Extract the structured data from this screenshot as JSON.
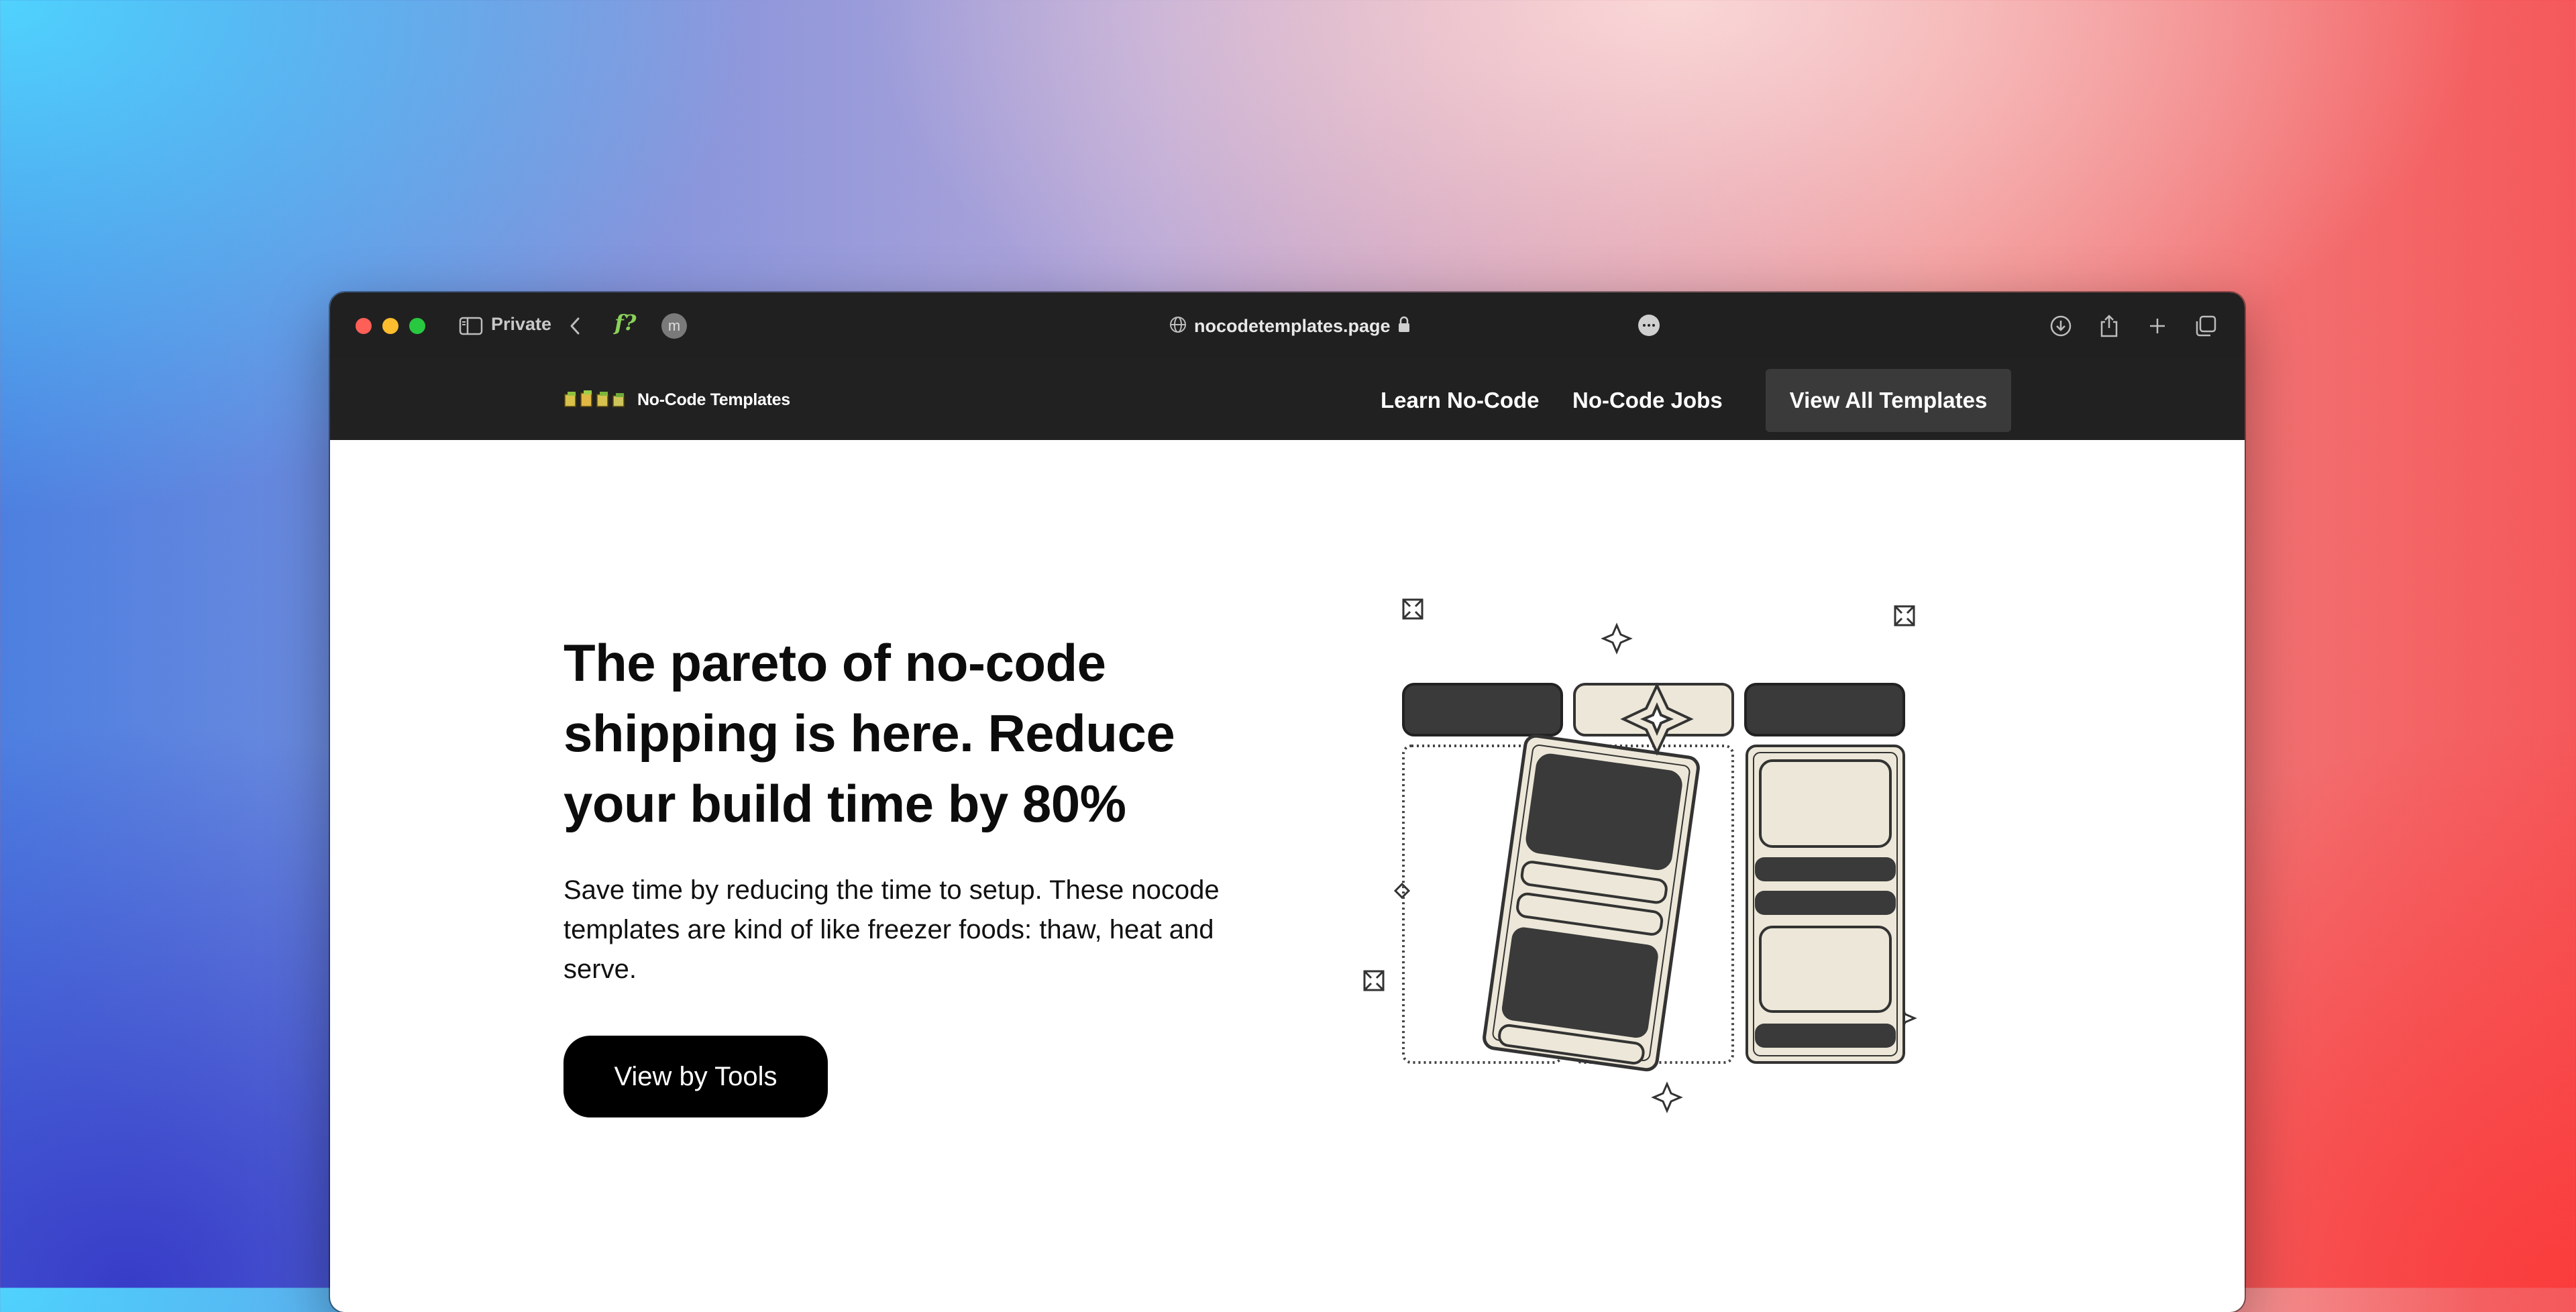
{
  "browser": {
    "private_label": "Private",
    "extension_label": "f?",
    "profile_initial": "m",
    "url": "nocodetemplates.page"
  },
  "site": {
    "brand_name": "No-Code Templates",
    "nav": {
      "learn": "Learn No-Code",
      "jobs": "No-Code Jobs",
      "cta": "View All Templates"
    }
  },
  "hero": {
    "title": "The pareto of no-code shipping is here. Reduce your build time by 80%",
    "subtitle": "Save time by reducing the time to setup. These nocode templates are kind of like freezer foods: thaw, heat and serve.",
    "button": "View by Tools"
  },
  "colors": {
    "dark_block": "#3a3a3a",
    "cream_block": "#ece7d8",
    "nav_bg": "#212121"
  }
}
